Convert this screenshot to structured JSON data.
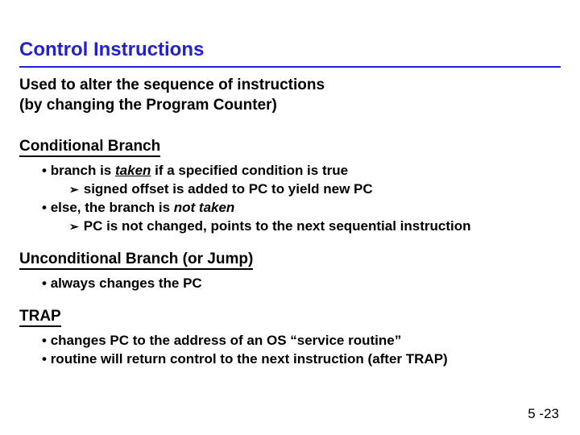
{
  "title": "Control Instructions",
  "intro_line1": "Used to alter the sequence of instructions",
  "intro_line2": "(by changing the Program Counter)",
  "sections": {
    "conditional": {
      "heading": "Conditional Branch",
      "b1_pre": "branch is ",
      "b1_em": "taken",
      "b1_post": " if a specified condition is true",
      "b1_sub": "signed offset is added to PC to yield new PC",
      "b2_pre": "else, the branch is ",
      "b2_em": "not taken",
      "b2_sub": "PC is not changed, points to the next sequential instruction"
    },
    "unconditional": {
      "heading": "Unconditional Branch (or Jump)",
      "b1": "always changes the PC"
    },
    "trap": {
      "heading": "TRAP",
      "b1": "changes PC to the address of an OS “service routine”",
      "b2": "routine will return control to the next instruction (after TRAP)"
    }
  },
  "page_number": "5 -23"
}
